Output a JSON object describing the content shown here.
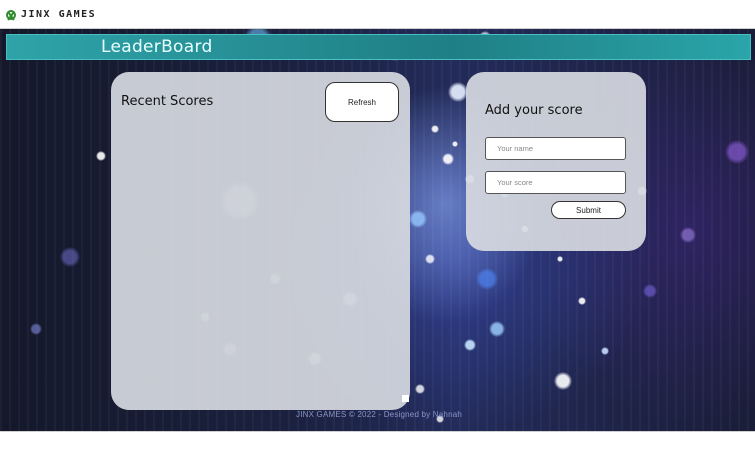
{
  "header": {
    "brand_name": "JINX GAMES",
    "logo_icon": "xbox-logo-icon"
  },
  "banner": {
    "title": "LeaderBoard"
  },
  "recent_scores": {
    "title": "Recent Scores",
    "refresh_label": "Refresh"
  },
  "add_score": {
    "title": "Add your score",
    "name_placeholder": "Your name",
    "score_placeholder": "Your score",
    "submit_label": "Submit"
  },
  "footer": {
    "text": "JINX GAMES © 2022 - Designed by Nahnah"
  },
  "colors": {
    "banner": "#2ea3a8",
    "panel": "#d7dae1",
    "logo": "#2e8b2e"
  }
}
